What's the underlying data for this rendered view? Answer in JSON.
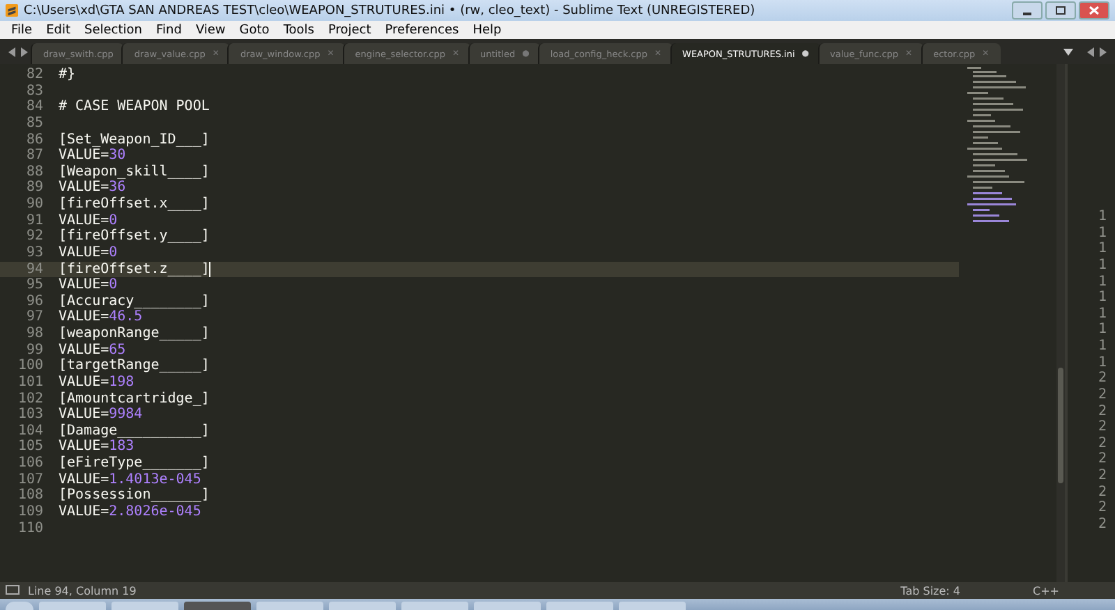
{
  "window": {
    "title": "C:\\Users\\xd\\GTA SAN ANDREAS TEST\\cleo\\WEAPON_STRUTURES.ini • (rw, cleo_text) - Sublime Text (UNREGISTERED)"
  },
  "menu": [
    "File",
    "Edit",
    "Selection",
    "Find",
    "View",
    "Goto",
    "Tools",
    "Project",
    "Preferences",
    "Help"
  ],
  "tabs": [
    {
      "label": "draw_swith.cpp",
      "selected": false
    },
    {
      "label": "draw_value.cpp",
      "selected": false,
      "marker": "✕"
    },
    {
      "label": "draw_window.cpp",
      "selected": false,
      "marker": "✕"
    },
    {
      "label": "engine_selector.cpp",
      "selected": false,
      "marker": "✕"
    },
    {
      "label": "untitled",
      "selected": false,
      "marker": "●"
    },
    {
      "label": "load_config_heck.cpp",
      "selected": false,
      "marker": "✕"
    },
    {
      "label": "WEAPON_STRUTURES.ini",
      "selected": true,
      "marker": "●"
    },
    {
      "label": "value_func.cpp",
      "selected": false,
      "marker": "✕"
    },
    {
      "label": "ector.cpp",
      "selected": false,
      "marker": "✕"
    }
  ],
  "lines": [
    {
      "number": "82",
      "current": false,
      "parts": [
        {
          "text": "#}",
          "kind": "plain"
        }
      ]
    },
    {
      "number": "83",
      "current": false
    },
    {
      "number": "84",
      "current": false,
      "parts": [
        {
          "text": "# CASE WEAPON POOL",
          "kind": "plain"
        }
      ]
    },
    {
      "number": "85",
      "current": false
    },
    {
      "number": "86",
      "current": false,
      "parts": [
        {
          "text": "[Set_Weapon_ID___]",
          "kind": "plain"
        }
      ]
    },
    {
      "number": "87",
      "current": false,
      "parts": [
        {
          "text": "VALUE=",
          "kind": "plain"
        },
        {
          "text": "30",
          "kind": "number"
        }
      ]
    },
    {
      "number": "88",
      "current": false,
      "parts": [
        {
          "text": "[Weapon_skill____]",
          "kind": "plain"
        }
      ]
    },
    {
      "number": "89",
      "current": false,
      "parts": [
        {
          "text": "VALUE=",
          "kind": "plain"
        },
        {
          "text": "36",
          "kind": "number"
        }
      ]
    },
    {
      "number": "90",
      "current": false,
      "parts": [
        {
          "text": "[fireOffset.x____]",
          "kind": "plain"
        }
      ]
    },
    {
      "number": "91",
      "current": false,
      "parts": [
        {
          "text": "VALUE=",
          "kind": "plain"
        },
        {
          "text": "0",
          "kind": "number"
        }
      ]
    },
    {
      "number": "92",
      "current": false,
      "parts": [
        {
          "text": "[fireOffset.y____]",
          "kind": "plain"
        }
      ]
    },
    {
      "number": "93",
      "current": false,
      "parts": [
        {
          "text": "VALUE=",
          "kind": "plain"
        },
        {
          "text": "0",
          "kind": "number"
        }
      ]
    },
    {
      "number": "94",
      "current": true,
      "parts": [
        {
          "text": "[fireOffset.z____]",
          "kind": "plain"
        }
      ]
    },
    {
      "number": "95",
      "current": false,
      "parts": [
        {
          "text": "VALUE=",
          "kind": "plain"
        },
        {
          "text": "0",
          "kind": "number"
        }
      ]
    },
    {
      "number": "96",
      "current": false,
      "parts": [
        {
          "text": "[Accuracy________]",
          "kind": "plain"
        }
      ]
    },
    {
      "number": "97",
      "current": false,
      "parts": [
        {
          "text": "VALUE=",
          "kind": "plain"
        },
        {
          "text": "46.5",
          "kind": "number"
        }
      ]
    },
    {
      "number": "98",
      "current": false,
      "parts": [
        {
          "text": "[weaponRange_____]",
          "kind": "plain"
        }
      ]
    },
    {
      "number": "99",
      "current": false,
      "parts": [
        {
          "text": "VALUE=",
          "kind": "plain"
        },
        {
          "text": "65",
          "kind": "number"
        }
      ]
    },
    {
      "number": "100",
      "current": false,
      "parts": [
        {
          "text": "[targetRange_____]",
          "kind": "plain"
        }
      ]
    },
    {
      "number": "101",
      "current": false,
      "parts": [
        {
          "text": "VALUE=",
          "kind": "plain"
        },
        {
          "text": "198",
          "kind": "number"
        }
      ]
    },
    {
      "number": "102",
      "current": false,
      "parts": [
        {
          "text": "[Amountcartridge_]",
          "kind": "plain"
        }
      ]
    },
    {
      "number": "103",
      "current": false,
      "parts": [
        {
          "text": "VALUE=",
          "kind": "plain"
        },
        {
          "text": "9984",
          "kind": "number"
        }
      ]
    },
    {
      "number": "104",
      "current": false,
      "parts": [
        {
          "text": "[Damage__________]",
          "kind": "plain"
        }
      ]
    },
    {
      "number": "105",
      "current": false,
      "parts": [
        {
          "text": "VALUE=",
          "kind": "plain"
        },
        {
          "text": "183",
          "kind": "number"
        }
      ]
    },
    {
      "number": "106",
      "current": false,
      "parts": [
        {
          "text": "[eFireType_______]",
          "kind": "plain"
        }
      ]
    },
    {
      "number": "107",
      "current": false,
      "parts": [
        {
          "text": "VALUE=",
          "kind": "plain"
        },
        {
          "text": "1.4013e-045",
          "kind": "number"
        }
      ]
    },
    {
      "number": "108",
      "current": false,
      "parts": [
        {
          "text": "[Possession______]",
          "kind": "plain"
        }
      ]
    },
    {
      "number": "109",
      "current": false,
      "parts": [
        {
          "text": "VALUE=",
          "kind": "plain"
        },
        {
          "text": "2.8026e-045",
          "kind": "number"
        }
      ]
    },
    {
      "number": "110",
      "current": false
    }
  ],
  "second_pane_line_numbers": [
    "1",
    "1",
    "1",
    "1",
    "1",
    "1",
    "1",
    "1",
    "1",
    "1",
    "2",
    "2",
    "2",
    "2",
    "2",
    "2",
    "2",
    "2",
    "2",
    "2"
  ],
  "status_bar": {
    "position": "Line 94, Column 19",
    "tab_size": "Tab Size: 4",
    "syntax": "C++"
  }
}
